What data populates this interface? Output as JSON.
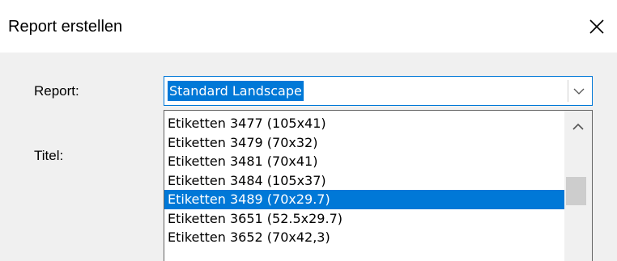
{
  "window": {
    "title": "Report erstellen",
    "close_icon": "close-icon"
  },
  "form": {
    "report_label": "Report:",
    "titel_label": "Titel:"
  },
  "report_combo": {
    "value": "Standard Landscape",
    "arrow_icon": "chevron-down-icon"
  },
  "dropdown": {
    "items": [
      {
        "label": "Etiketten 3477 (105x41)"
      },
      {
        "label": "Etiketten 3479 (70x32)"
      },
      {
        "label": "Etiketten 3481 (70x41)"
      },
      {
        "label": "Etiketten 3484 (105x37)"
      },
      {
        "label": "Etiketten 3489 (70x29.7)"
      },
      {
        "label": "Etiketten 3651 (52.5x29.7)"
      },
      {
        "label": "Etiketten 3652 (70x42,3)"
      }
    ],
    "selected_label": "Etiketten 3489 (70x29.7)",
    "scroll_up_icon": "chevron-up-icon"
  },
  "colors": {
    "accent": "#0078d7",
    "dialog_bg": "#f0f0f0"
  }
}
